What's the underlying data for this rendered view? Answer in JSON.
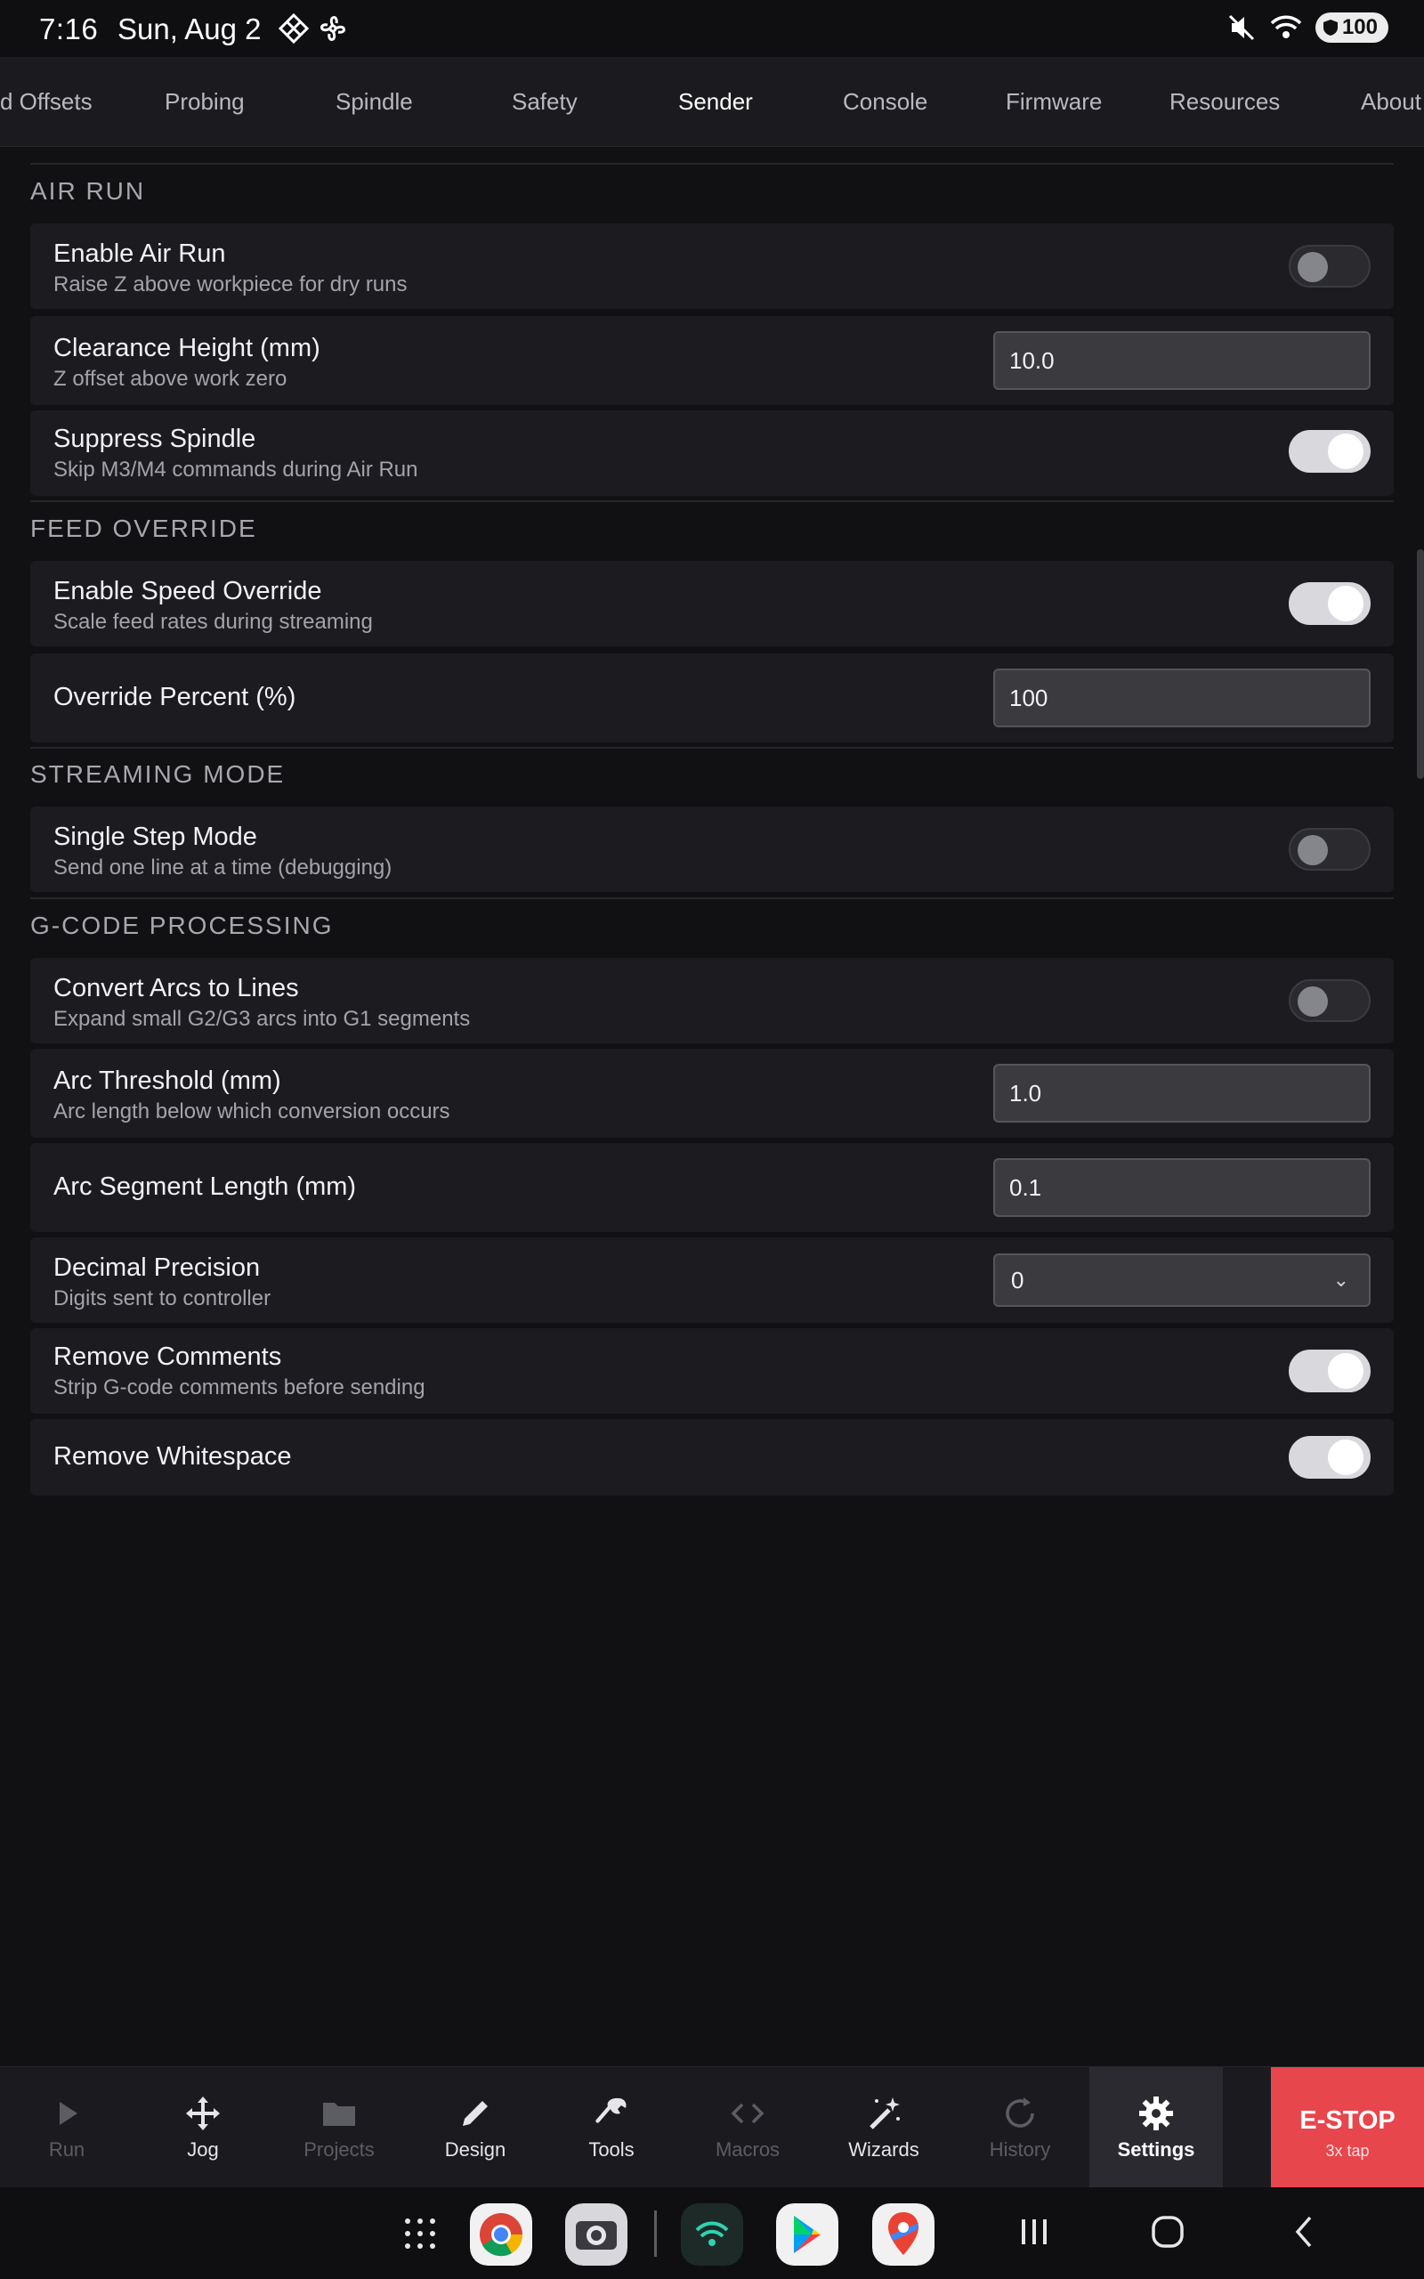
{
  "status_bar": {
    "time": "7:16",
    "date": "Sun, Aug 2",
    "battery": "100"
  },
  "tabs": [
    {
      "label": "d Offsets"
    },
    {
      "label": "Probing"
    },
    {
      "label": "Spindle"
    },
    {
      "label": "Safety"
    },
    {
      "label": "Sender",
      "active": true
    },
    {
      "label": "Console"
    },
    {
      "label": "Firmware"
    },
    {
      "label": "Resources"
    },
    {
      "label": "About"
    }
  ],
  "sections": {
    "air_run": {
      "title": "AIR RUN",
      "enable": {
        "label": "Enable Air Run",
        "desc": "Raise Z above workpiece for dry runs",
        "on": false
      },
      "clearance": {
        "label": "Clearance Height (mm)",
        "desc": "Z offset above work zero",
        "value": "10.0"
      },
      "suppress": {
        "label": "Suppress Spindle",
        "desc": "Skip M3/M4 commands during Air Run",
        "on": true
      }
    },
    "feed_override": {
      "title": "FEED OVERRIDE",
      "enable": {
        "label": "Enable Speed Override",
        "desc": "Scale feed rates during streaming",
        "on": true
      },
      "percent": {
        "label": "Override Percent (%)",
        "value": "100"
      }
    },
    "streaming_mode": {
      "title": "STREAMING MODE",
      "single_step": {
        "label": "Single Step Mode",
        "desc": "Send one line at a time (debugging)",
        "on": false
      }
    },
    "gcode_processing": {
      "title": "G-CODE PROCESSING",
      "convert_arcs": {
        "label": "Convert Arcs to Lines",
        "desc": "Expand small G2/G3 arcs into G1 segments",
        "on": false
      },
      "arc_threshold": {
        "label": "Arc Threshold (mm)",
        "desc": "Arc length below which conversion occurs",
        "value": "1.0"
      },
      "arc_segment": {
        "label": "Arc Segment Length (mm)",
        "value": "0.1"
      },
      "decimal_precision": {
        "label": "Decimal Precision",
        "desc": "Digits sent to controller",
        "value": "0"
      },
      "remove_comments": {
        "label": "Remove Comments",
        "desc": "Strip G-code comments before sending",
        "on": true
      },
      "remove_whitespace": {
        "label": "Remove Whitespace",
        "on": true
      }
    }
  },
  "bottom_nav": {
    "items": [
      {
        "label": "Run",
        "icon": "play-icon",
        "enabled": false
      },
      {
        "label": "Jog",
        "icon": "move-arrows-icon",
        "enabled": true
      },
      {
        "label": "Projects",
        "icon": "folder-icon",
        "enabled": false
      },
      {
        "label": "Design",
        "icon": "pencil-icon",
        "enabled": true
      },
      {
        "label": "Tools",
        "icon": "wrench-icon",
        "enabled": true
      },
      {
        "label": "Macros",
        "icon": "code-brackets-icon",
        "enabled": false
      },
      {
        "label": "Wizards",
        "icon": "magic-wand-icon",
        "enabled": true
      },
      {
        "label": "History",
        "icon": "history-icon",
        "enabled": false
      },
      {
        "label": "Settings",
        "icon": "gear-icon",
        "enabled": true,
        "active": true
      }
    ],
    "estop": {
      "label": "E-STOP",
      "hint": "3x tap"
    }
  },
  "colors": {
    "background": "#111114",
    "row": "#1c1c20",
    "estop": "#e8464d",
    "toggle_on": "#d9d9dd"
  }
}
